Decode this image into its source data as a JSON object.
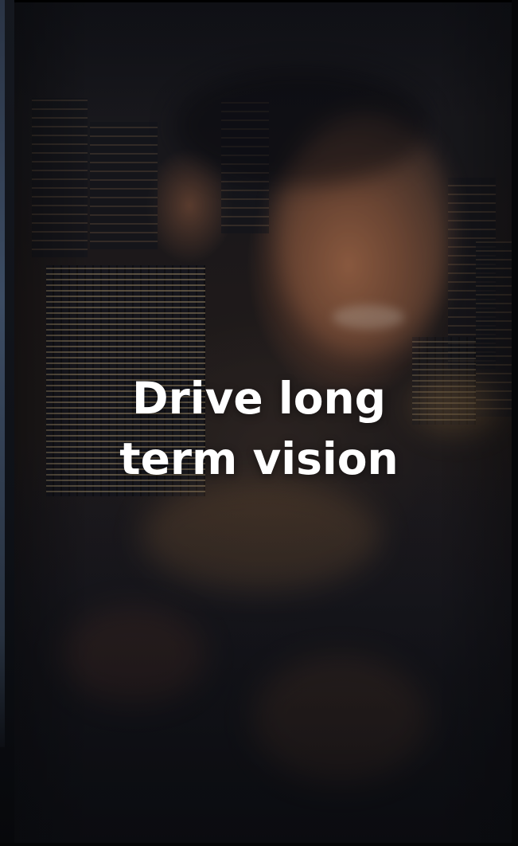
{
  "hero": {
    "image": "city-night-double-exposure-smiling-man",
    "headline_line1": "Drive long",
    "headline_line2": "term vision"
  },
  "colors": {
    "headline_text": "#ffffff",
    "background": "#0b0d12",
    "skin_tone_glow": "#be7850",
    "city_lights": "#f0d296"
  }
}
